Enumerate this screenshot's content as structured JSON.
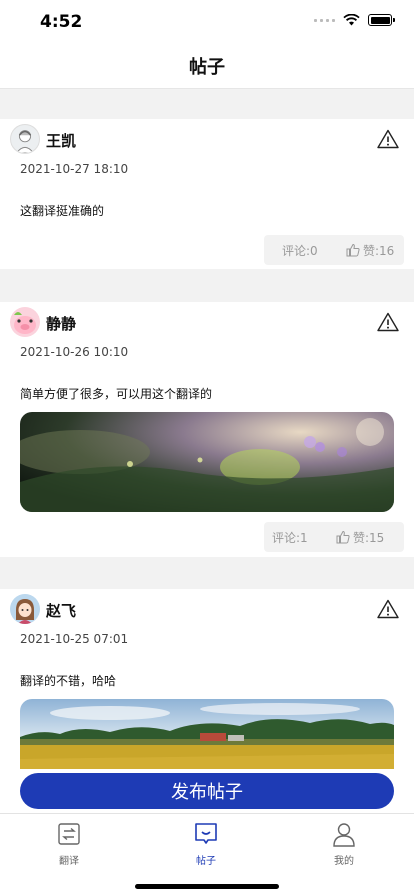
{
  "status_bar": {
    "time": "4:52"
  },
  "nav": {
    "title": "帖子"
  },
  "posts": [
    {
      "username": "王凯",
      "date": "2021-10-27 18:10",
      "content": "这翻译挺准确的",
      "comments": "评论:0",
      "likes": "赞:16",
      "avatar_icon": "avatar-sketch-icon"
    },
    {
      "username": "静静",
      "date": "2021-10-26 10:10",
      "content": "简单方便了很多，可以用这个翻译的",
      "comments": "评论:1",
      "likes": "赞:15",
      "avatar_icon": "avatar-cartoon-pig-icon"
    },
    {
      "username": "赵飞",
      "date": "2021-10-25 07:01",
      "content": "翻译的不错，哈哈",
      "avatar_icon": "avatar-cartoon-girl-icon"
    }
  ],
  "publish_button": {
    "label": "发布帖子"
  },
  "tabs": [
    {
      "label": "翻译",
      "icon": "translate-icon",
      "active": false
    },
    {
      "label": "帖子",
      "icon": "chat-bubble-icon",
      "active": true
    },
    {
      "label": "我的",
      "icon": "person-icon",
      "active": false
    }
  ],
  "colors": {
    "accent": "#1e3bb5",
    "background": "#f2f2f2",
    "card": "#ffffff"
  }
}
